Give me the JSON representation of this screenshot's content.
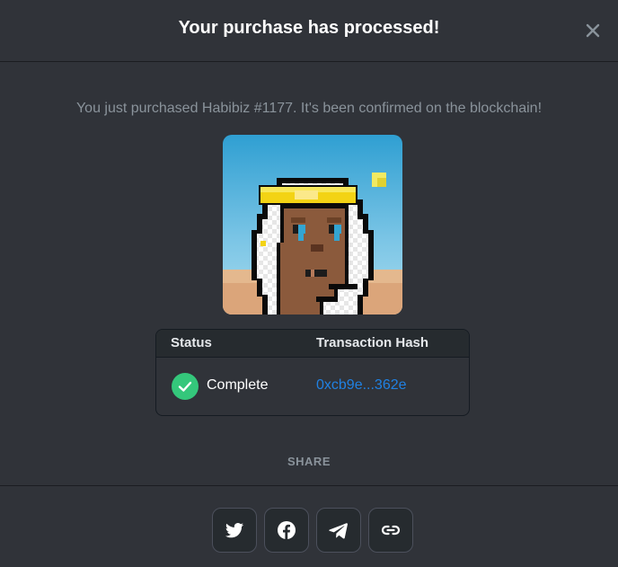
{
  "modal": {
    "title": "Your purchase has processed!",
    "message": "You just purchased Habibiz #1177. It's been confirmed on the blockchain!",
    "close_icon": "close-icon"
  },
  "nft": {
    "name": "Habibiz #1177",
    "image_icon": "pixel-art-nft"
  },
  "transaction_table": {
    "headers": [
      "Status",
      "Transaction Hash"
    ],
    "status": "Complete",
    "status_icon": "check-circle-icon",
    "hash": "0xcb9e...362e"
  },
  "share": {
    "label": "SHARE",
    "buttons": [
      "twitter-icon",
      "facebook-icon",
      "telegram-icon",
      "link-icon"
    ]
  },
  "colors": {
    "background": "#303339",
    "accent_link": "#2081e2",
    "success": "#34c77b"
  }
}
